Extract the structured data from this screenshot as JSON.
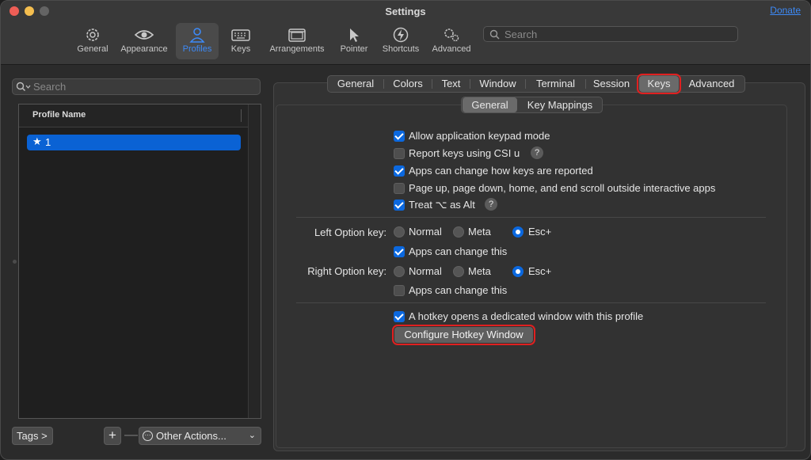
{
  "window": {
    "title": "Settings",
    "donate": "Donate"
  },
  "toolbar": {
    "items": [
      {
        "label": "General",
        "icon": "gear-icon"
      },
      {
        "label": "Appearance",
        "icon": "eye-icon"
      },
      {
        "label": "Profiles",
        "icon": "person-icon"
      },
      {
        "label": "Keys",
        "icon": "keyboard-icon"
      },
      {
        "label": "Arrangements",
        "icon": "windows-icon"
      },
      {
        "label": "Pointer",
        "icon": "pointer-icon"
      },
      {
        "label": "Shortcuts",
        "icon": "bolt-icon"
      },
      {
        "label": "Advanced",
        "icon": "gears-icon"
      }
    ],
    "search_placeholder": "Search",
    "accent": "#3d8af7"
  },
  "left": {
    "search_placeholder": "Search",
    "column_header": "Profile Name",
    "profiles": [
      {
        "name": "1",
        "default": "★"
      }
    ],
    "tags_label": "Tags >",
    "add_label": "+",
    "remove_label": "—",
    "other_actions": "Other Actions..."
  },
  "tabs": [
    "General",
    "Colors",
    "Text",
    "Window",
    "Terminal",
    "Session",
    "Keys",
    "Advanced"
  ],
  "subtabs": [
    "General",
    "Key Mappings"
  ],
  "options": {
    "keypad": "Allow application keypad mode",
    "csi": "Report keys using CSI u",
    "apps_change_report": "Apps can change how keys are reported",
    "page_scroll": "Page up, page down, home, and end scroll outside interactive apps",
    "treat_alt": "Treat ⌥ as Alt",
    "help": "?"
  },
  "left_option": {
    "label": "Left Option key:",
    "normal": "Normal",
    "meta": "Meta",
    "esc": "Esc+",
    "apps_change": "Apps can change this"
  },
  "right_option": {
    "label": "Right Option key:",
    "normal": "Normal",
    "meta": "Meta",
    "esc": "Esc+",
    "apps_change": "Apps can change this"
  },
  "hotkey": {
    "checkbox_label": "A hotkey opens a dedicated window with this profile",
    "button_label": "Configure Hotkey Window"
  },
  "colors": {
    "selection": "#0a62d4",
    "checkbox_on": "#0b68df",
    "highlight_outline": "#e02020"
  }
}
